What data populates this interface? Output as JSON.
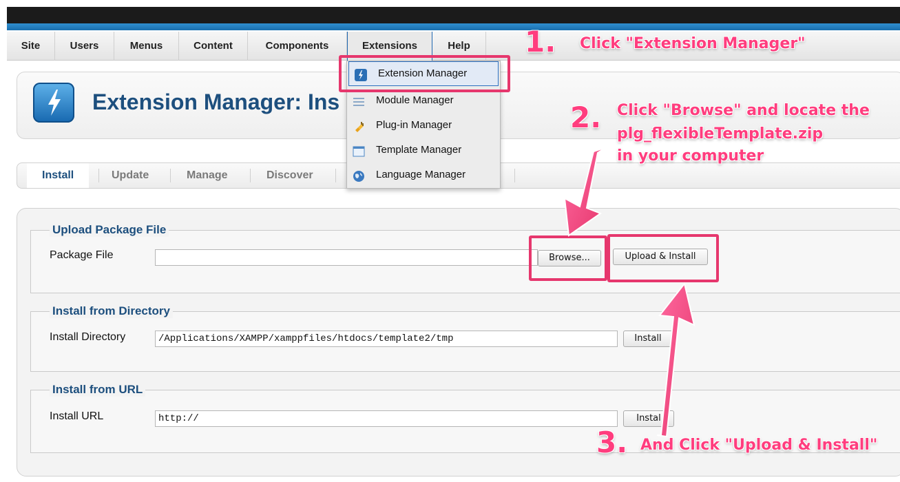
{
  "menubar": {
    "items": [
      "Site",
      "Users",
      "Menus",
      "Content",
      "Components",
      "Extensions",
      "Help"
    ]
  },
  "header": {
    "title": "Extension Manager: Ins"
  },
  "tabs": {
    "items": [
      "Install",
      "Update",
      "Manage",
      "Discover"
    ]
  },
  "dropdown": {
    "items": [
      "Extension Manager",
      "Module Manager",
      "Plug-in Manager",
      "Template Manager",
      "Language Manager"
    ]
  },
  "upload": {
    "legend": "Upload Package File",
    "label": "Package File",
    "value": "",
    "browse_label": "Browse...",
    "install_label": "Upload & Install"
  },
  "directory": {
    "legend": "Install from Directory",
    "label": "Install Directory",
    "value": "/Applications/XAMPP/xamppfiles/htdocs/template2/tmp",
    "install_label": "Install"
  },
  "url": {
    "legend": "Install from URL",
    "label": "Install URL",
    "value": "http://",
    "install_label": "Instal"
  },
  "annotations": {
    "step1_num": "1.",
    "step1_text": "Click \"Extension Manager\"",
    "step2_num": "2.",
    "step2_line1": "Click \"Browse\" and locate the",
    "step2_line2": "plg_flexibleTemplate.zip",
    "step2_line3": "in your computer",
    "step3_num": "3.",
    "step3_text": "And Click \"Upload & Install\""
  },
  "colors": {
    "accent": "#1d4f7e",
    "annotation": "#ff3d7e",
    "highlight_box": "#e6376d",
    "blue_bar": "#2f8fd0"
  },
  "icons": [
    "lightning-icon",
    "menu-lines-icon",
    "plug-icon",
    "window-icon",
    "globe-icon"
  ]
}
